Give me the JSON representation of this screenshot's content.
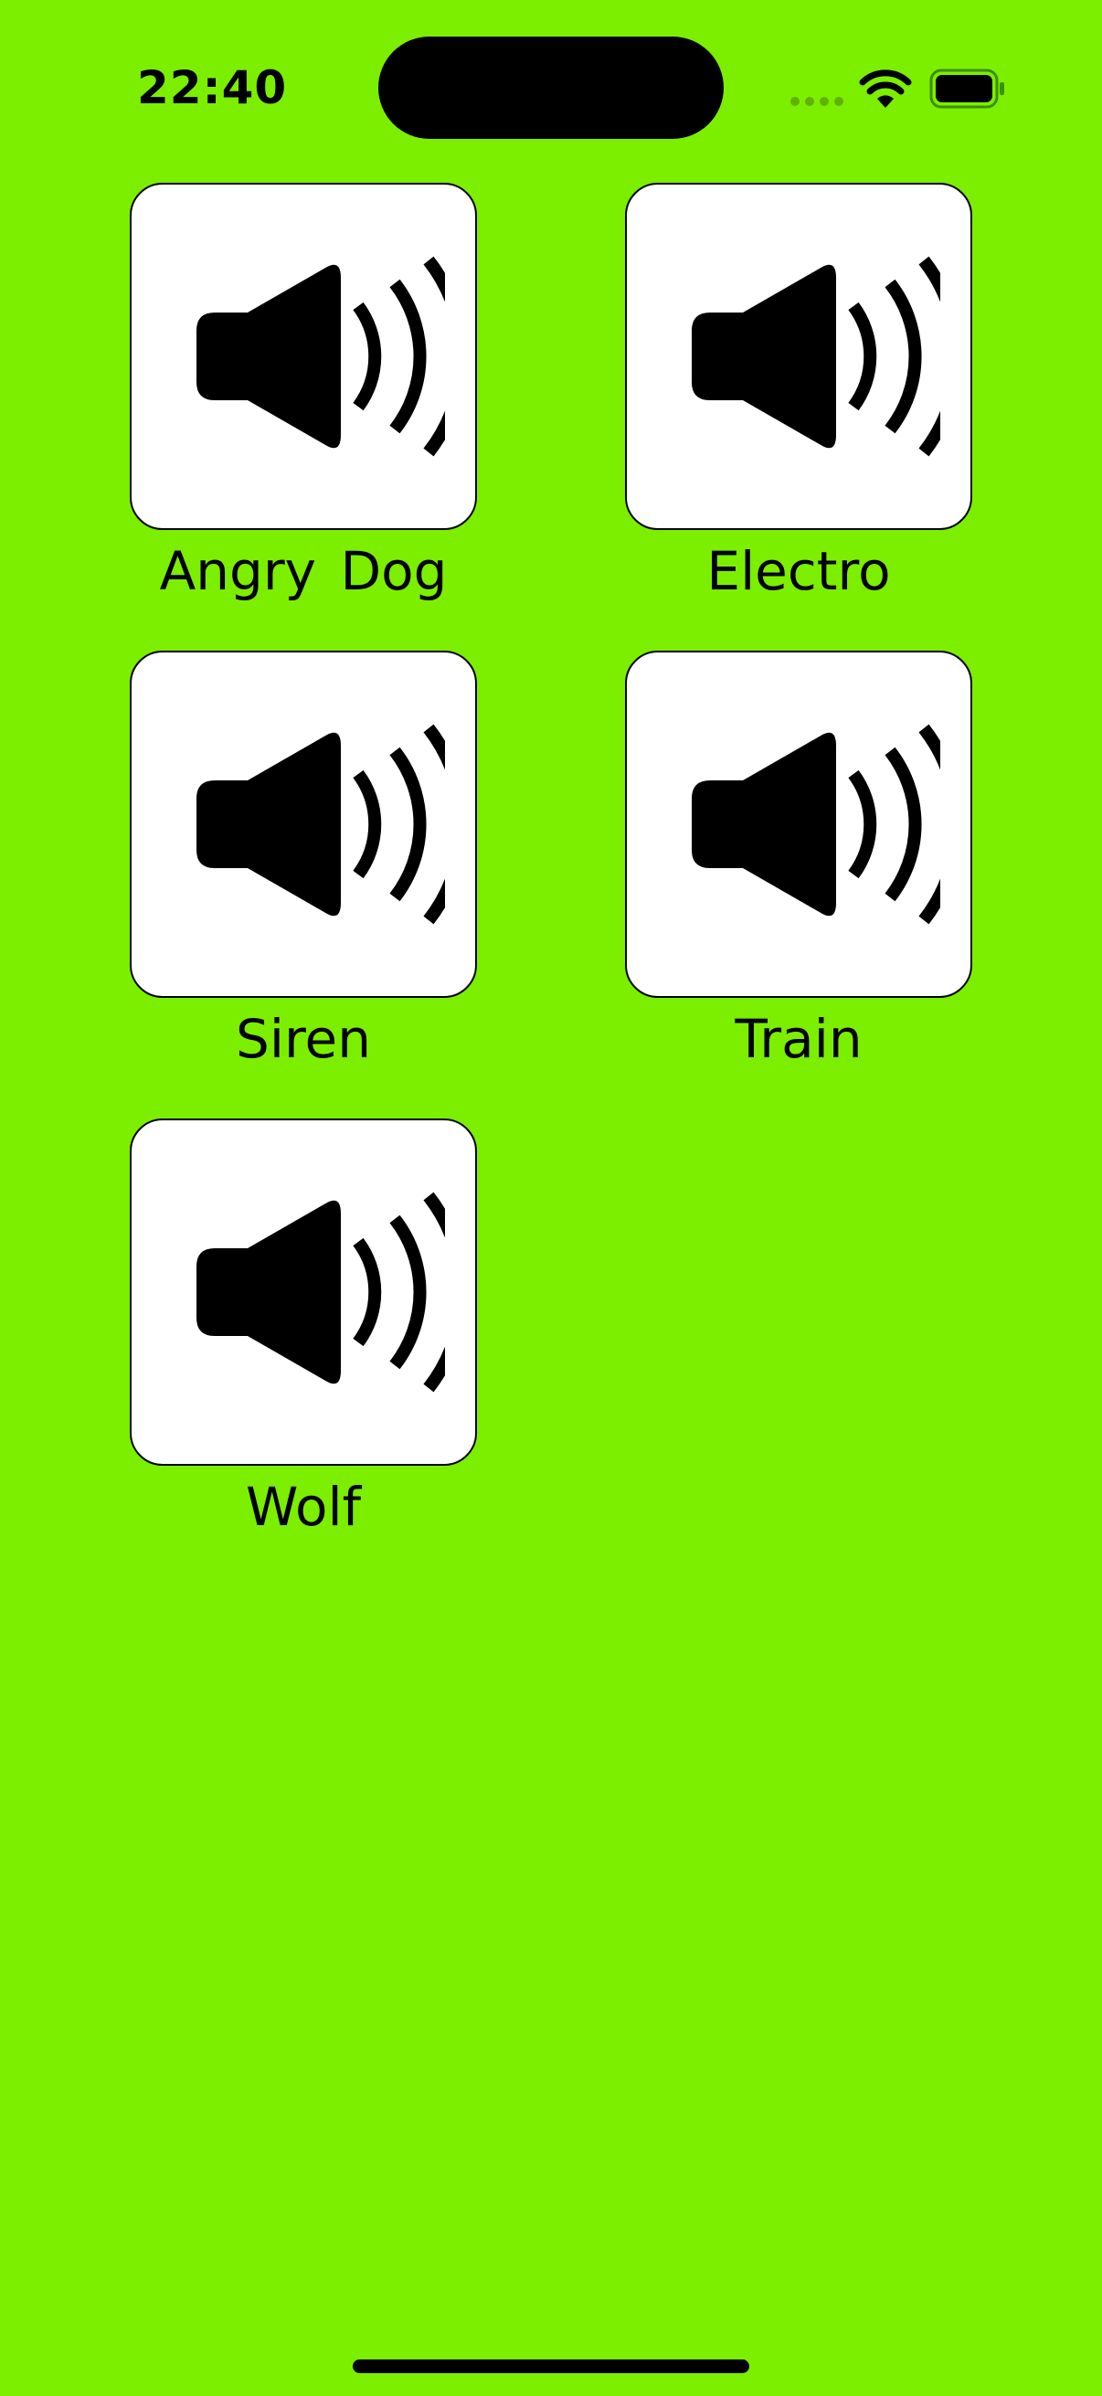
{
  "status_bar": {
    "time": "22:40",
    "signal_icon": "cellular-signal-dots-icon",
    "wifi_icon": "wifi-icon",
    "battery_icon": "battery-icon"
  },
  "sounds": [
    {
      "label": "Angry Dog",
      "icon": "speaker-icon"
    },
    {
      "label": "Electro",
      "icon": "speaker-icon"
    },
    {
      "label": "Siren",
      "icon": "speaker-icon"
    },
    {
      "label": "Train",
      "icon": "speaker-icon"
    },
    {
      "label": "Wolf",
      "icon": "speaker-icon"
    }
  ],
  "colors": {
    "background": "#7CEF00",
    "tile": "#FFFFFF",
    "ink": "#000000"
  }
}
